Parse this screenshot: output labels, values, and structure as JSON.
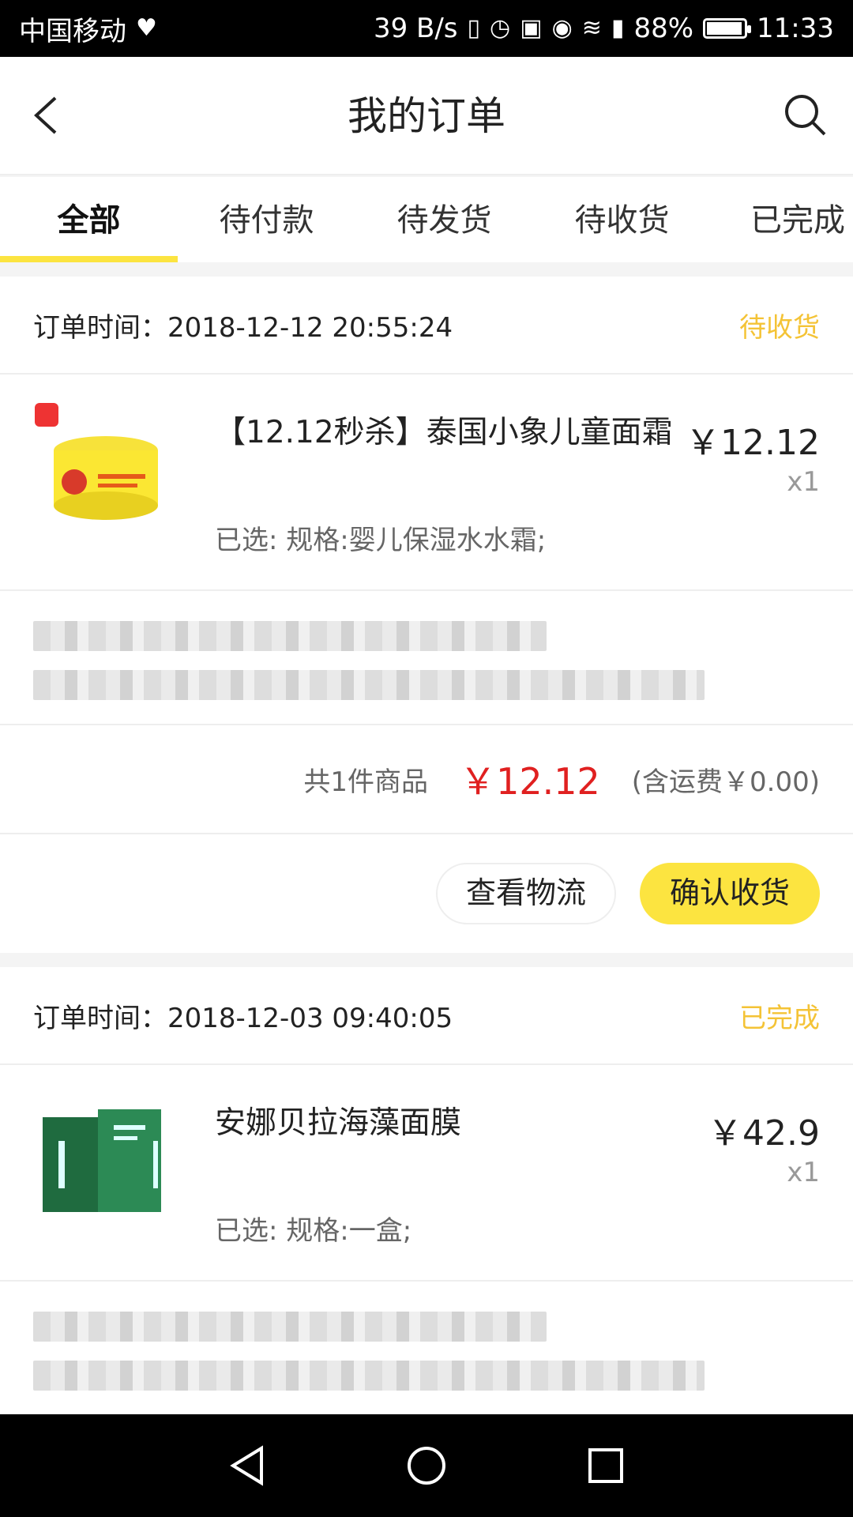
{
  "status_bar": {
    "carrier": "中国移动",
    "net_speed": "39 B/s",
    "battery_pct": "88%",
    "time": "11:33"
  },
  "header": {
    "title": "我的订单"
  },
  "tabs": [
    "全部",
    "待付款",
    "待发货",
    "待收货",
    "已完成"
  ],
  "active_tab": 0,
  "orders": [
    {
      "time_label": "订单时间：",
      "time": "2018-12-12 20:55:24",
      "status": "待收货",
      "status_color": "#f4c336",
      "item": {
        "name": "【12.12秒杀】泰国小象儿童面霜",
        "price": "￥12.12",
        "qty": "x1",
        "spec": "已选: 规格:婴儿保湿水水霜;"
      },
      "summary": {
        "count": "共1件商品",
        "total": "￥12.12",
        "shipping": "(含运费￥0.00)"
      },
      "actions": [
        "查看物流",
        "确认收货"
      ]
    },
    {
      "time_label": "订单时间：",
      "time": "2018-12-03 09:40:05",
      "status": "已完成",
      "status_color": "#f4c336",
      "item": {
        "name": "安娜贝拉海藻面膜",
        "price": "￥42.9",
        "qty": "x1",
        "spec": "已选: 规格:一盒;"
      }
    }
  ],
  "accent_color": "#fce440",
  "price_color": "#e02020"
}
